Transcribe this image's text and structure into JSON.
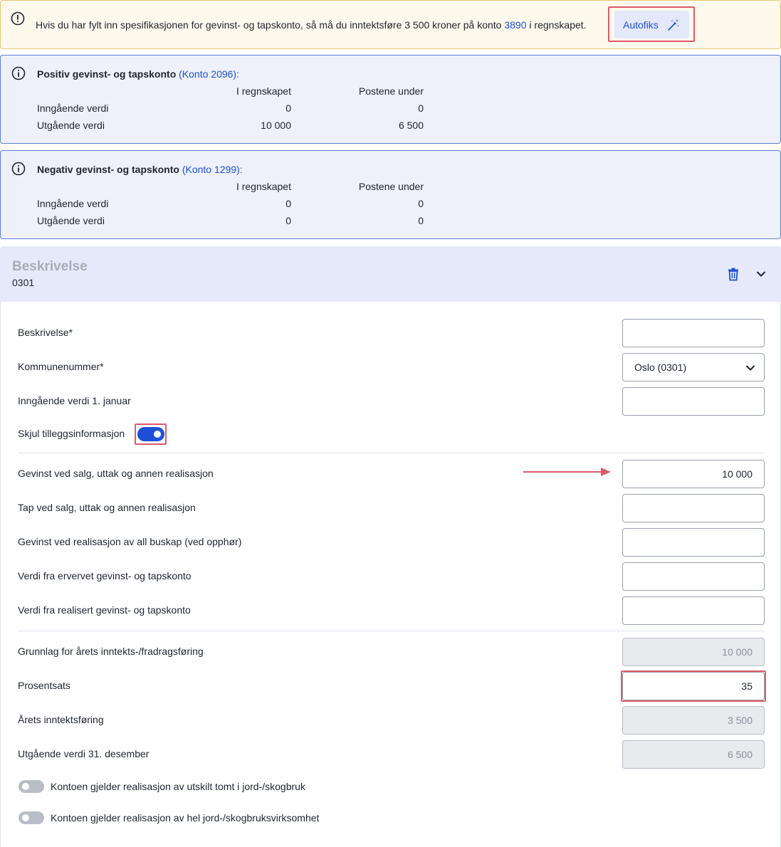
{
  "warning": {
    "message_start": "Hvis du har fylt inn spesifikasjonen for gevinst- og tapskonto, så må du inntektsføre 3 500 kroner på konto ",
    "account_link": "3890",
    "message_end": " i regnskapet.",
    "autofix_label": "Autofiks"
  },
  "info_boxes": [
    {
      "title": "Positiv gevinst- og tapskonto",
      "account_link": "(Konto 2096)",
      "colon": ":",
      "col1": "I regnskapet",
      "col2": "Postene under",
      "rows": [
        {
          "label": "Inngående verdi",
          "v1": "0",
          "v2": "0"
        },
        {
          "label": "Utgående verdi",
          "v1": "10 000",
          "v2": "6 500"
        }
      ]
    },
    {
      "title": "Negativ gevinst- og tapskonto",
      "account_link": "(Konto 1299)",
      "colon": ":",
      "col1": "I regnskapet",
      "col2": "Postene under",
      "rows": [
        {
          "label": "Inngående verdi",
          "v1": "0",
          "v2": "0"
        },
        {
          "label": "Utgående verdi",
          "v1": "0",
          "v2": "0"
        }
      ]
    }
  ],
  "section": {
    "title": "Beskrivelse",
    "subtitle": "0301"
  },
  "form": {
    "beskrivelse_label": "Beskrivelse*",
    "beskrivelse_value": "",
    "kommune_label": "Kommunenummer*",
    "kommune_value": "Oslo (0301)",
    "inngaende_label": "Inngående verdi 1. januar",
    "inngaende_value": "",
    "skjul_label": "Skjul tilleggsinformasjon",
    "skjul_on": true,
    "gevinst_salg_label": "Gevinst ved salg, uttak og annen realisasjon",
    "gevinst_salg_value": "10 000",
    "tap_salg_label": "Tap ved salg, uttak og annen realisasjon",
    "tap_salg_value": "",
    "gevinst_buskap_label": "Gevinst ved realisasjon av all buskap (ved opphør)",
    "gevinst_buskap_value": "",
    "verdi_ervervet_label": "Verdi fra ervervet gevinst- og tapskonto",
    "verdi_ervervet_value": "",
    "verdi_realisert_label": "Verdi fra realisert gevinst- og tapskonto",
    "verdi_realisert_value": "",
    "grunnlag_label": "Grunnlag for årets inntekts-/fradragsføring",
    "grunnlag_value": "10 000",
    "prosent_label": "Prosentsats",
    "prosent_value": "35",
    "arets_label": "Årets inntektsføring",
    "arets_value": "3 500",
    "utgaende_label": "Utgående verdi 31. desember",
    "utgaende_value": "6 500",
    "toggle_tomt_label": "Kontoen gjelder realisasjon av utskilt tomt i jord-/skogbruk",
    "toggle_tomt_on": false,
    "toggle_hel_label": "Kontoen gjelder realisasjon av hel jord-/skogbruksvirksomhet",
    "toggle_hel_on": false
  },
  "colors": {
    "accent": "#1d4fd8",
    "highlight": "#de5a6a",
    "warning_bg": "#fdf9ec",
    "info_bg": "#eef1fb"
  }
}
